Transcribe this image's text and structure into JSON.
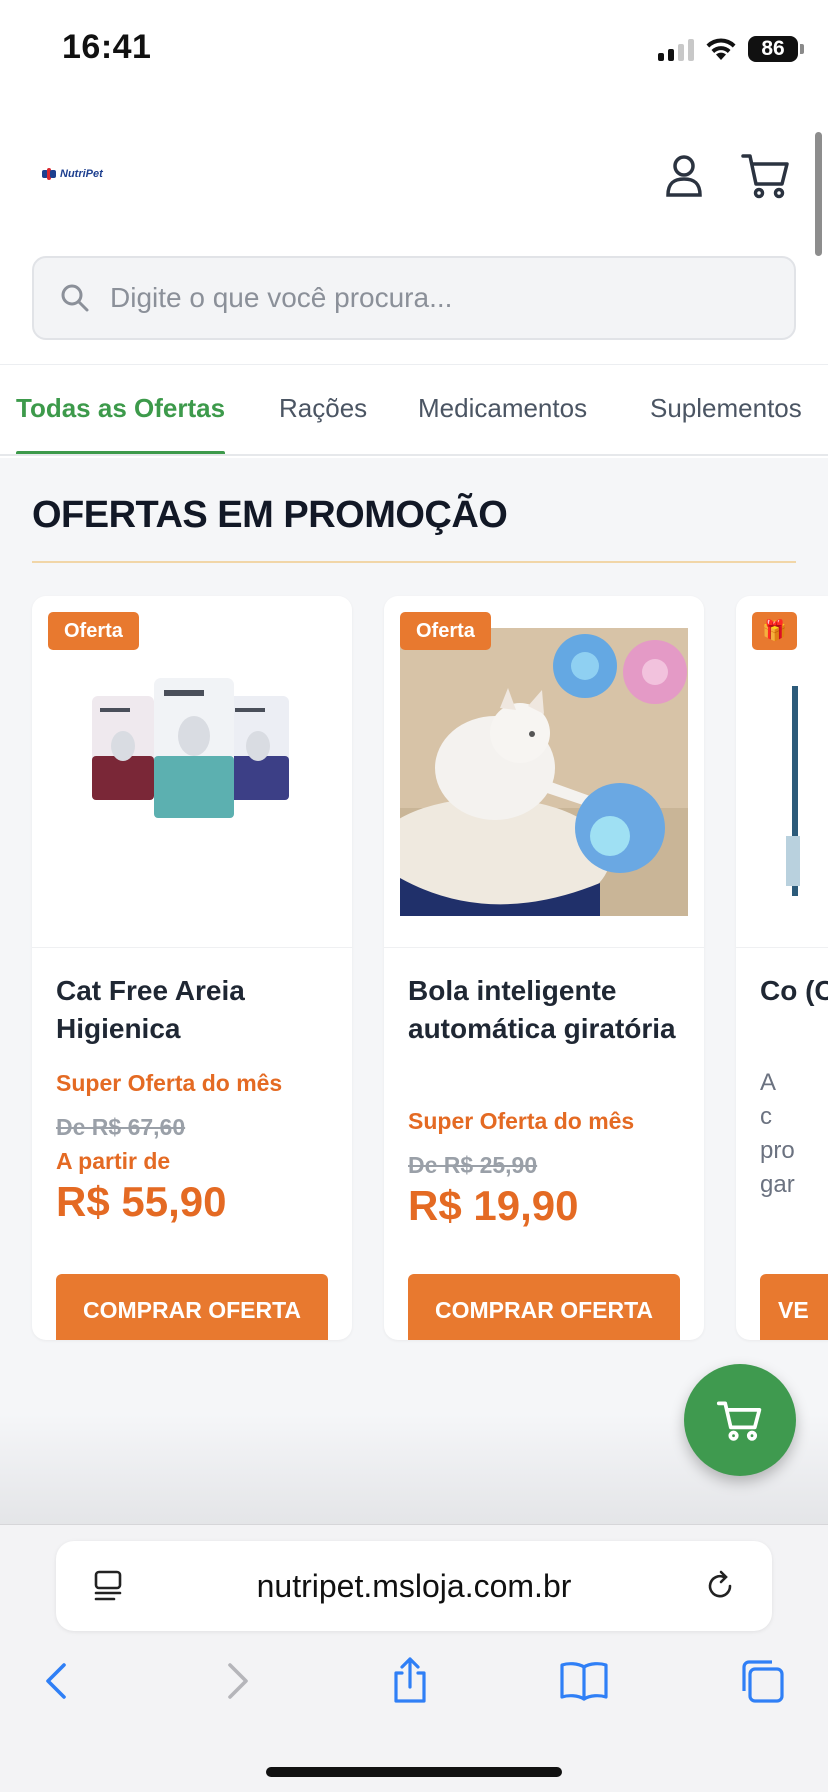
{
  "status_bar": {
    "time": "16:41",
    "battery": "86"
  },
  "header": {
    "logo_text": "NutriPet"
  },
  "search": {
    "placeholder": "Digite o que você procura..."
  },
  "tabs": [
    {
      "label": "Todas as Ofertas",
      "active": true
    },
    {
      "label": "Rações",
      "active": false
    },
    {
      "label": "Medicamentos",
      "active": false
    },
    {
      "label": "Suplementos",
      "active": false
    }
  ],
  "section": {
    "title": "OFERTAS EM PROMOÇÃO"
  },
  "products": [
    {
      "badge": "Oferta",
      "title": "Cat Free Areia Higienica",
      "promo": "Super Oferta do mês",
      "old_price": "De R$ 67,60",
      "from_label": "A partir de",
      "price": "R$ 55,90",
      "button": "COMPRAR OFERTA"
    },
    {
      "badge": "Oferta",
      "title": "Bola inteligente automática giratória",
      "promo": "Super Oferta do mês",
      "old_price": "De R$ 25,90",
      "from_label": "",
      "price": "R$ 19,90",
      "button": "COMPRAR OFERTA"
    },
    {
      "badge": "🎁",
      "title": "Co (Ca",
      "description": "A c pro gar",
      "button": "VE"
    }
  ],
  "browser": {
    "url": "nutripet.msloja.com.br"
  },
  "colors": {
    "accent_green": "#3d9a4b",
    "accent_orange": "#e8792f"
  }
}
